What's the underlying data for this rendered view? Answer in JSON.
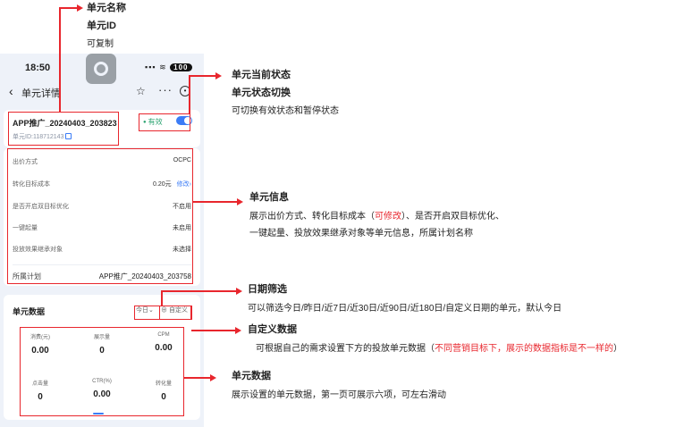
{
  "phone": {
    "time": "18:50",
    "battery": "100",
    "signal": "▪▪▪ ≋",
    "nav_title": "单元详情",
    "back_icon": "‹",
    "star_icon": "☆",
    "more_icon": "···",
    "close_icon": "◉"
  },
  "unit": {
    "name": "APP推广_20240403_203823",
    "id_label": "单元ID:118712143",
    "status": "有效"
  },
  "info": {
    "rows": [
      {
        "label": "出价方式",
        "value": "OCPC"
      },
      {
        "label": "转化目标成本",
        "value": "0.20元",
        "action": "修改›"
      },
      {
        "label": "是否开启双目标优化",
        "value": "不启用"
      },
      {
        "label": "一键起量",
        "value": "未启用"
      },
      {
        "label": "投放效果继承对象",
        "value": "未选择"
      }
    ],
    "plan_label": "所属计划",
    "plan_value": "APP推广_20240403_203758"
  },
  "data_section": {
    "title": "单元数据",
    "date_filter": "今日⌄",
    "custom_filter": "⊕ 自定义",
    "metrics": [
      {
        "label": "消费(元)",
        "value": "0.00"
      },
      {
        "label": "展示量",
        "value": "0"
      },
      {
        "label": "CPM",
        "value": "0.00"
      },
      {
        "label": "点击量",
        "value": "0"
      },
      {
        "label": "CTR(%)",
        "value": "0.00"
      },
      {
        "label": "转化量",
        "value": "0"
      }
    ]
  },
  "annotations": {
    "a1_title": "单元名称",
    "a1_line2": "单元ID",
    "a1_line3": "可复制",
    "a2_title": "单元当前状态",
    "a2_line2": "单元状态切换",
    "a2_line3": "可切换有效状态和暂停状态",
    "a3_title": "单元信息",
    "a3_line2a": "展示出价方式、转化目标成本（",
    "a3_line2b": "可修改",
    "a3_line2c": "）、是否开启双目标优化、",
    "a3_line3": "一键起量、投放效果继承对象等单元信息，所属计划名称",
    "a4_title": "日期筛选",
    "a4_line2": "可以筛选今日/昨日/近7日/近30日/近90日/近180日/自定义日期的单元，默认今日",
    "a5_title": "自定义数据",
    "a5_line2a": "可根据自己的需求设置下方的投放单元数据（",
    "a5_line2b": "不同营销目标下，展示的数据指标是不一样的",
    "a5_line2c": "）",
    "a6_title": "单元数据",
    "a6_line2": "展示设置的单元数据，第一页可展示六项，可左右滑动"
  },
  "colors": {
    "accent": "#3b7cf6",
    "highlight": "#e8262d",
    "active": "#2ba471"
  }
}
